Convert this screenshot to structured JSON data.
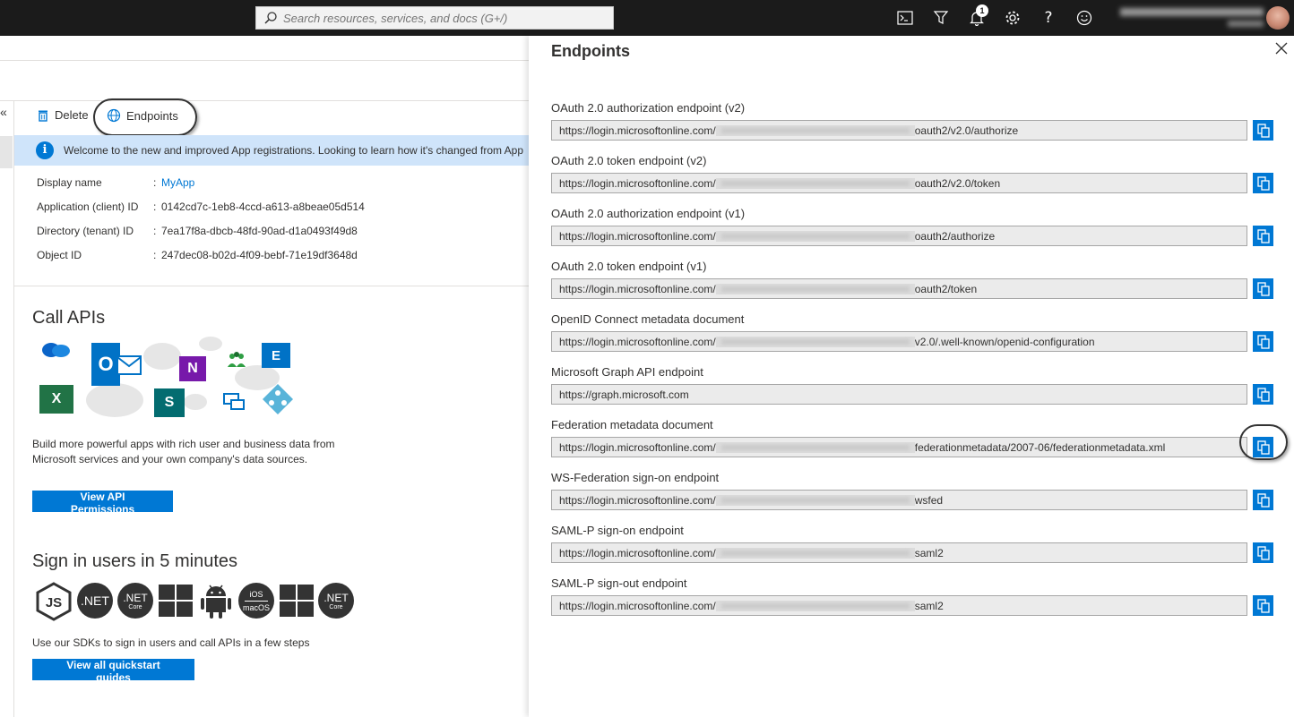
{
  "topbar": {
    "search_placeholder": "Search resources, services, and docs (G+/)",
    "notification_count": "1"
  },
  "commands": {
    "delete_label": "Delete",
    "endpoints_label": "Endpoints"
  },
  "banner": {
    "text": "Welcome to the new and improved App registrations. Looking to learn how it's changed from App"
  },
  "properties": [
    {
      "label": "Display name",
      "value": "MyApp"
    },
    {
      "label": "Application (client) ID",
      "value": "0142cd7c-1eb8-4ccd-a613-a8beae05d514"
    },
    {
      "label": "Directory (tenant) ID",
      "value": "7ea17f8a-dbcb-48fd-90ad-d1a0493f49d8"
    },
    {
      "label": "Object ID",
      "value": "247dec08-b02d-4f09-bebf-71e19df3648d"
    }
  ],
  "colon": ":",
  "call_apis": {
    "title": "Call APIs",
    "description": "Build more powerful apps with rich user and business data from Microsoft services and your own company's data sources.",
    "button": "View API Permissions"
  },
  "sign_in": {
    "title": "Sign in users in 5 minutes",
    "description": "Use our SDKs to sign in users and call APIs in a few steps",
    "button": "View all quickstart guides",
    "sdk_net": ".NET",
    "sdk_core": "Core",
    "sdk_ios": "iOS",
    "sdk_macos": "macOS"
  },
  "panel": {
    "title": "Endpoints",
    "endpoints": [
      {
        "label": "OAuth 2.0 authorization endpoint (v2)",
        "prefix": "https://login.microsoftonline.com/",
        "suffix": "oauth2/v2.0/authorize"
      },
      {
        "label": "OAuth 2.0 token endpoint (v2)",
        "prefix": "https://login.microsoftonline.com/",
        "suffix": "oauth2/v2.0/token"
      },
      {
        "label": "OAuth 2.0 authorization endpoint (v1)",
        "prefix": "https://login.microsoftonline.com/",
        "suffix": "oauth2/authorize"
      },
      {
        "label": "OAuth 2.0 token endpoint (v1)",
        "prefix": "https://login.microsoftonline.com/",
        "suffix": "oauth2/token"
      },
      {
        "label": "OpenID Connect metadata document",
        "prefix": "https://login.microsoftonline.com/",
        "suffix": "v2.0/.well-known/openid-configuration"
      },
      {
        "label": "Microsoft Graph API endpoint",
        "prefix": "https://graph.microsoft.com",
        "suffix": ""
      },
      {
        "label": "Federation metadata document",
        "prefix": "https://login.microsoftonline.com/",
        "suffix": "federationmetadata/2007-06/federationmetadata.xml"
      },
      {
        "label": "WS-Federation sign-on endpoint",
        "prefix": "https://login.microsoftonline.com/",
        "suffix": "wsfed"
      },
      {
        "label": "SAML-P sign-on endpoint",
        "prefix": "https://login.microsoftonline.com/",
        "suffix": "saml2"
      },
      {
        "label": "SAML-P sign-out endpoint",
        "prefix": "https://login.microsoftonline.com/",
        "suffix": "saml2"
      }
    ]
  },
  "colors": {
    "accent": "#0078d4",
    "topbar": "#1b1b1b",
    "banner": "#cfe4fa"
  }
}
